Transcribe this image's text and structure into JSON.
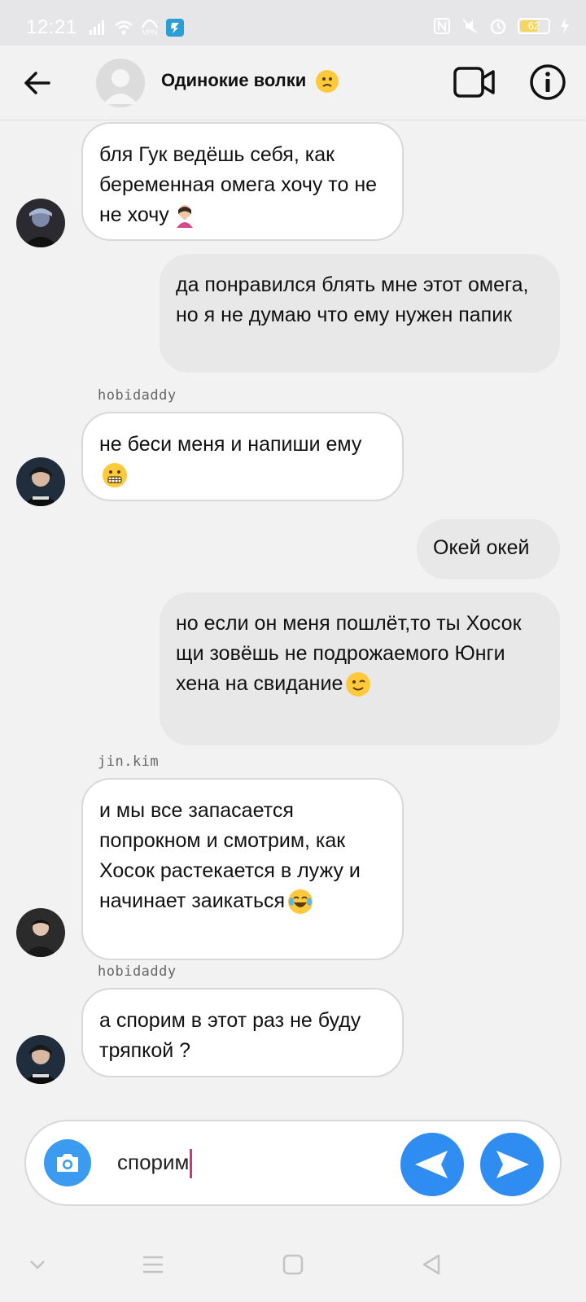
{
  "status_bar": {
    "time": "12:21",
    "battery_level": "62",
    "icons": [
      "signal-icon",
      "wifi-icon",
      "vpn-icon",
      "app-notification-icon",
      "nfc-icon",
      "mute-icon",
      "alarm-icon",
      "battery-icon",
      "charging-icon"
    ],
    "vpn_label": "VPN"
  },
  "header": {
    "title": "Одинокие волки",
    "title_emoji": "slightly-frowning-face-emoji",
    "icons": [
      "back-arrow-icon",
      "video-call-icon",
      "info-icon"
    ]
  },
  "messages": [
    {
      "direction": "in",
      "sender": "",
      "text": "бля Гук ведёшь себя, как беременная омега хочу то не не хочу",
      "emoji": "woman-facepalming-emoji"
    },
    {
      "direction": "out",
      "text": "да понравился блять мне этот омега, но я не думаю что ему нужен папик"
    },
    {
      "direction": "in",
      "sender": "hobidaddy",
      "text": "не беси меня и напиши ему",
      "emoji": "grimacing-face-emoji"
    },
    {
      "direction": "out",
      "text": "Окей окей"
    },
    {
      "direction": "out",
      "text": "но если он меня пошлёт,то ты Хосок щи зовёшь не подрожаемого Юнги хена на свидание",
      "emoji": "winking-face-emoji"
    },
    {
      "direction": "in",
      "sender": "jin.kim",
      "text": "и мы все запасается попрокном и смотрим, как Хосок растекается в лужу и начинает заикаться",
      "emoji": "tears-of-joy-emoji"
    },
    {
      "direction": "in",
      "sender": "hobidaddy",
      "text": "а спорим в этот раз не буду тряпкой ?"
    }
  ],
  "composer": {
    "value": "спорим",
    "icons": [
      "camera-icon",
      "send-left-icon",
      "send-icon"
    ]
  },
  "nav_bar": {
    "icons": [
      "nav-chevron-down-icon",
      "nav-menu-icon",
      "nav-home-icon",
      "nav-back-icon"
    ]
  },
  "colors": {
    "accent": "#2f8cf0",
    "camera": "#3a9bf0",
    "caret": "#e0307a",
    "incoming_bubble": "#ffffff",
    "outgoing_bubble": "#e8e8e8",
    "background": "#f2f2f2"
  }
}
